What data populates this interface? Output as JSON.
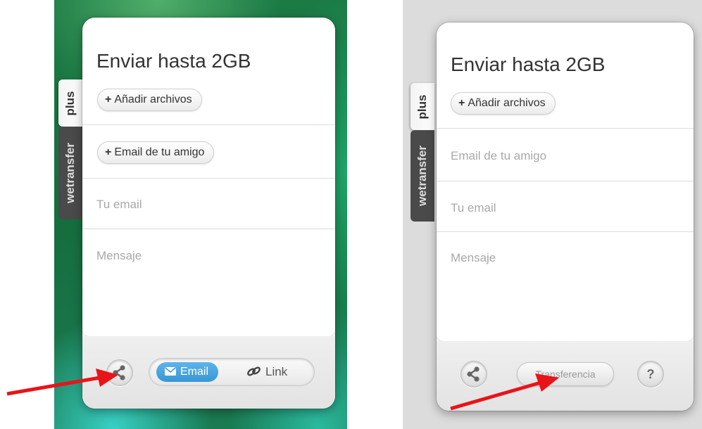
{
  "left_panel": {
    "title": "Enviar hasta 2GB",
    "add_files_label": "Añadir archivos",
    "add_friend_label": "Email de tu amigo",
    "your_email_placeholder": "Tu email",
    "message_placeholder": "Mensaje",
    "tab_plus": "plus",
    "tab_brand": "wetransfer",
    "email_toggle_label": "Email",
    "link_toggle_label": "Link"
  },
  "right_panel": {
    "title": "Enviar hasta 2GB",
    "add_files_label": "Añadir archivos",
    "friend_email_placeholder": "Email de tu amigo",
    "your_email_placeholder": "Tu email",
    "message_placeholder": "Mensaje",
    "tab_plus": "plus",
    "tab_brand": "wetransfer",
    "transfer_label": "Transferencia",
    "help_label": "?"
  },
  "colors": {
    "accent_blue": "#3b9ad9",
    "arrow_red": "#e8141a",
    "tab_dark": "#4a4a4a"
  },
  "icons": [
    "share-icon",
    "mail-icon",
    "link-icon",
    "help-icon",
    "plus-icon"
  ]
}
